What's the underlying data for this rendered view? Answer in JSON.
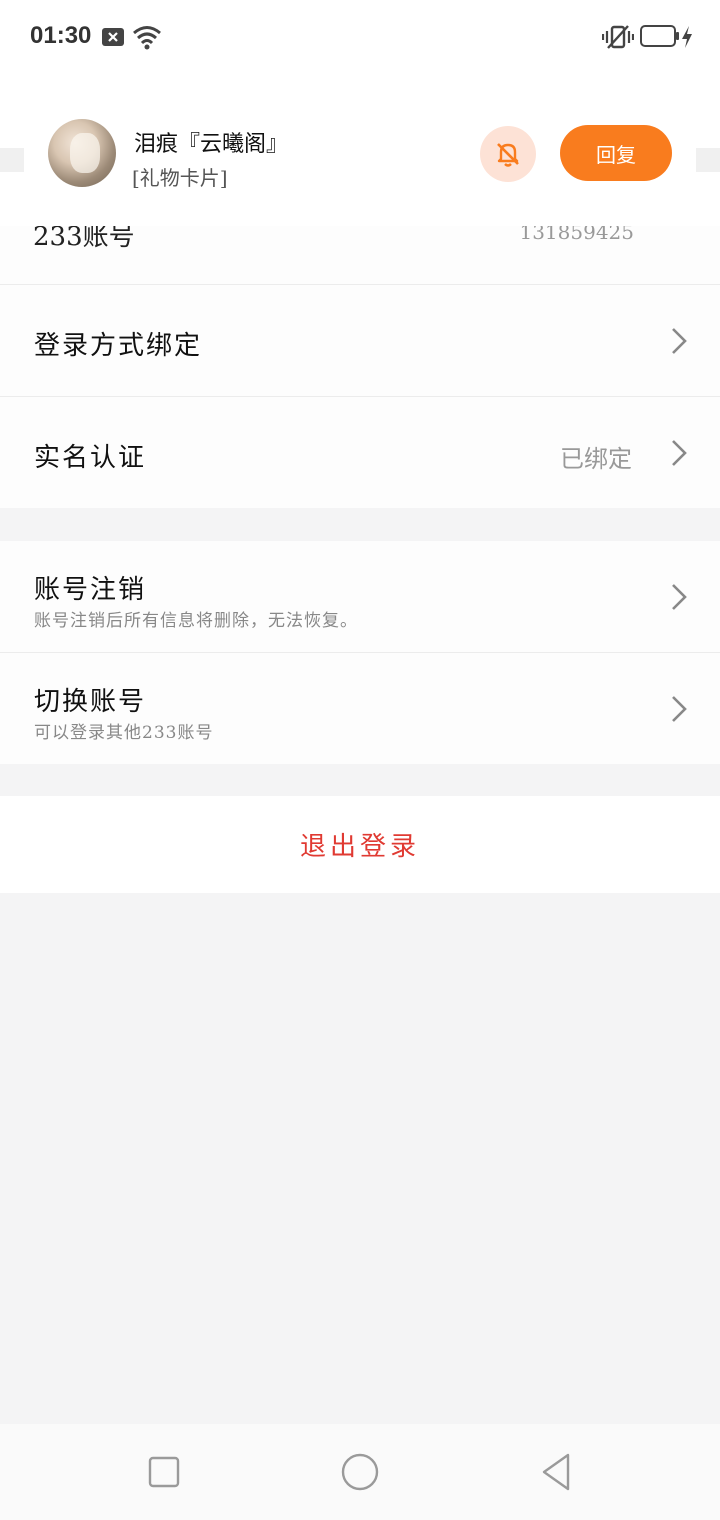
{
  "status_bar": {
    "time": "01:30",
    "icons": [
      "notification-x-icon",
      "wifi-icon",
      "vibrate-icon",
      "battery-icon",
      "charging-bolt-icon"
    ]
  },
  "notification": {
    "sender": "泪痕『云曦阁』",
    "message": "[礼物卡片]",
    "mute_icon": "bell-off-icon",
    "reply_label": "回复",
    "accent_color": "#f97c1e"
  },
  "settings": {
    "partial_row": {
      "label": "233账号",
      "value": "131859425"
    },
    "rows": [
      {
        "title": "登录方式绑定",
        "value": "",
        "subtitle": ""
      },
      {
        "title": "实名认证",
        "value": "已绑定",
        "subtitle": ""
      },
      {
        "title": "账号注销",
        "value": "",
        "subtitle": "账号注销后所有信息将删除，无法恢复。"
      },
      {
        "title": "切换账号",
        "value": "",
        "subtitle": "可以登录其他233账号"
      }
    ],
    "logout_label": "退出登录",
    "logout_color": "#e03a32"
  },
  "nav_bar": {
    "buttons": [
      "recent-apps-icon",
      "home-icon",
      "back-icon"
    ]
  }
}
